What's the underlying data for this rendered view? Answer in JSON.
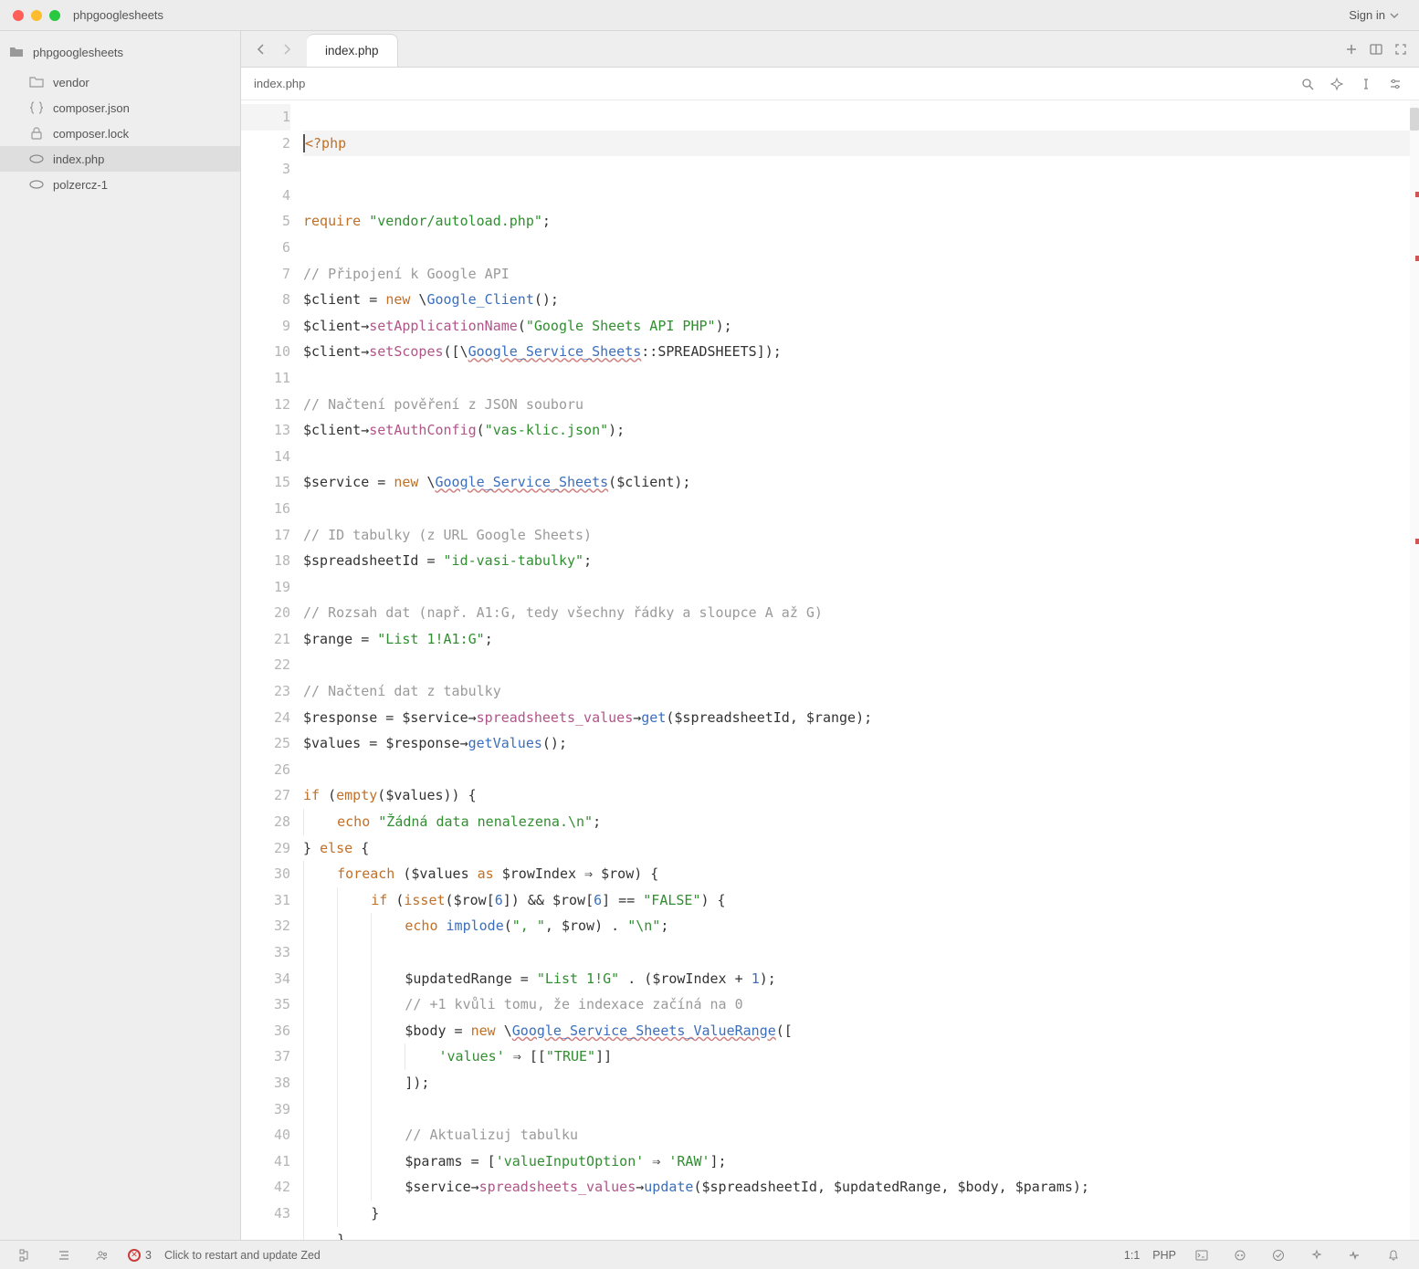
{
  "title": "phpgooglesheets",
  "signin": "Sign in",
  "project": "phpgooglesheets",
  "tree": [
    {
      "icon": "folder",
      "label": "vendor"
    },
    {
      "icon": "json",
      "label": "composer.json"
    },
    {
      "icon": "lock",
      "label": "composer.lock"
    },
    {
      "icon": "php",
      "label": "index.php",
      "selected": true
    },
    {
      "icon": "php",
      "label": "polzercz-1"
    }
  ],
  "tab": "index.php",
  "breadcrumb": "index.php",
  "status": {
    "errors": "3",
    "update": "Click to restart and update Zed",
    "pos": "1:1",
    "lang": "PHP"
  },
  "code": {
    "l1": "<?php",
    "l3_req": "require",
    "l3_str": "\"vendor/autoload.php\"",
    "l3_end": ";",
    "l5": "// Připojení k Google API",
    "l6a": "$client",
    "l6b": " = ",
    "l6c": "new",
    "l6d": " \\",
    "l6e": "Google_Client",
    "l6f": "();",
    "l7a": "$client",
    "l7b": "→",
    "l7c": "setApplicationName",
    "l7d": "(",
    "l7e": "\"Google Sheets API PHP\"",
    "l7f": ");",
    "l8a": "$client",
    "l8b": "→",
    "l8c": "setScopes",
    "l8d": "([\\",
    "l8e": "Google_Service_Sheets",
    "l8f": "::SPREADSHEETS]);",
    "l10": "// Načtení pověření z JSON souboru",
    "l11a": "$client",
    "l11b": "→",
    "l11c": "setAuthConfig",
    "l11d": "(",
    "l11e": "\"vas-klic.json\"",
    "l11f": ");",
    "l13a": "$service",
    "l13b": " = ",
    "l13c": "new",
    "l13d": " \\",
    "l13e": "Google_Service_Sheets",
    "l13f": "(",
    "l13g": "$client",
    "l13h": ");",
    "l15": "// ID tabulky (z URL Google Sheets)",
    "l16a": "$spreadsheetId",
    "l16b": " = ",
    "l16c": "\"id-vasi-tabulky\"",
    "l16d": ";",
    "l18": "// Rozsah dat (např. A1:G, tedy všechny řádky a sloupce A až G)",
    "l19a": "$range",
    "l19b": " = ",
    "l19c": "\"List 1!A1:G\"",
    "l19d": ";",
    "l21": "// Načtení dat z tabulky",
    "l22a": "$response",
    "l22b": " = ",
    "l22c": "$service",
    "l22d": "→",
    "l22e": "spreadsheets_values",
    "l22f": "→",
    "l22g": "get",
    "l22h": "(",
    "l22i": "$spreadsheetId",
    "l22j": ", ",
    "l22k": "$range",
    "l22l": ");",
    "l23a": "$values",
    "l23b": " = ",
    "l23c": "$response",
    "l23d": "→",
    "l23e": "getValues",
    "l23f": "();",
    "l25a": "if",
    "l25b": " (",
    "l25c": "empty",
    "l25d": "(",
    "l25e": "$values",
    "l25f": ")) {",
    "l26a": "echo",
    "l26b": " ",
    "l26c": "\"Žádná data nenalezena.\\n\"",
    "l26d": ";",
    "l27a": "} ",
    "l27b": "else",
    "l27c": " {",
    "l28a": "foreach",
    "l28b": " (",
    "l28c": "$values",
    "l28d": " ",
    "l28e": "as",
    "l28f": " ",
    "l28g": "$rowIndex",
    "l28h": " ⇒ ",
    "l28i": "$row",
    "l28j": ") {",
    "l29a": "if",
    "l29b": " (",
    "l29c": "isset",
    "l29d": "(",
    "l29e": "$row",
    "l29f": "[",
    "l29g": "6",
    "l29h": "]) && ",
    "l29i": "$row",
    "l29j": "[",
    "l29k": "6",
    "l29l": "] == ",
    "l29m": "\"FALSE\"",
    "l29n": ") {",
    "l30a": "echo",
    "l30b": " ",
    "l30c": "implode",
    "l30d": "(",
    "l30e": "\", \"",
    "l30f": ", ",
    "l30g": "$row",
    "l30h": ") . ",
    "l30i": "\"\\n\"",
    "l30j": ";",
    "l32a": "$updatedRange",
    "l32b": " = ",
    "l32c": "\"List 1!G\"",
    "l32d": " . (",
    "l32e": "$rowIndex",
    "l32f": " + ",
    "l32g": "1",
    "l32h": ");",
    "l33": "// +1 kvůli tomu, že indexace začíná na 0",
    "l34a": "$body",
    "l34b": " = ",
    "l34c": "new",
    "l34d": " \\",
    "l34e": "Google_Service_Sheets_ValueRange",
    "l34f": "([",
    "l35a": "'values'",
    "l35b": " ⇒ [[",
    "l35c": "\"TRUE\"",
    "l35d": "]]",
    "l36": "]);",
    "l38": "// Aktualizuj tabulku",
    "l39a": "$params",
    "l39b": " = [",
    "l39c": "'valueInputOption'",
    "l39d": " ⇒ ",
    "l39e": "'RAW'",
    "l39f": "];",
    "l40a": "$service",
    "l40b": "→",
    "l40c": "spreadsheets_values",
    "l40d": "→",
    "l40e": "update",
    "l40f": "(",
    "l40g": "$spreadsheetId",
    "l40h": ", ",
    "l40i": "$updatedRange",
    "l40j": ", ",
    "l40k": "$body",
    "l40l": ", ",
    "l40m": "$params",
    "l40n": ");",
    "l41": "}",
    "l42": "}",
    "l43": "}"
  }
}
